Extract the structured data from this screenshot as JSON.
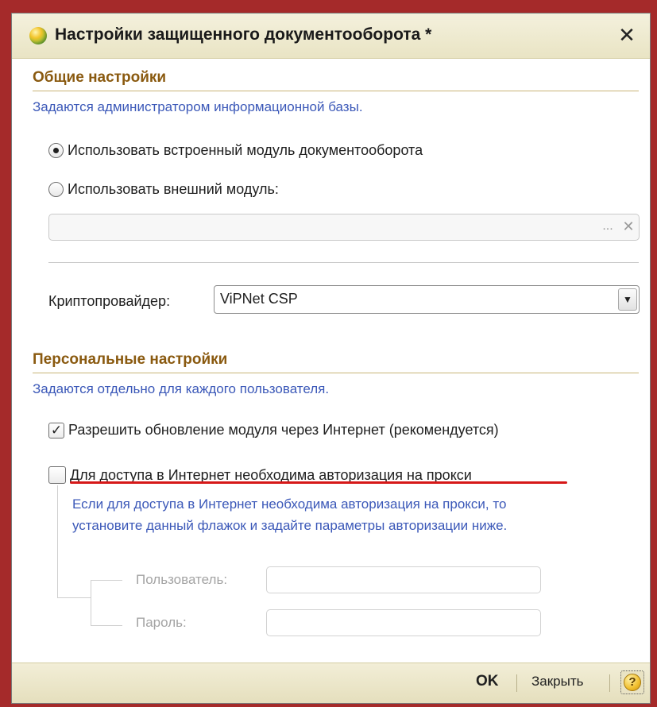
{
  "window": {
    "title": "Настройки защищенного документооборота *",
    "close_symbol": "✕"
  },
  "general": {
    "heading": "Общие настройки",
    "hint": "Задаются администратором информационной базы.",
    "radio_builtin": "Использовать встроенный модуль документооборота",
    "radio_external": "Использовать внешний модуль:",
    "selected": "builtin",
    "external_path_value": "",
    "browse_symbol": "...",
    "clear_symbol": "✕",
    "crypto_label": "Криптопровайдер:",
    "crypto_value": "ViPNet CSP"
  },
  "personal": {
    "heading": "Персональные настройки",
    "hint": "Задаются отдельно для каждого пользователя.",
    "update_checkbox_label": "Разрешить обновление модуля через Интернет (рекомендуется)",
    "update_checked": true,
    "proxy_checkbox_label": "Для доступа в Интернет необходима авторизация на прокси",
    "proxy_checked": false,
    "proxy_note_line1": "Если для доступа в Интернет необходима авторизация на прокси, то",
    "proxy_note_line2": "установите данный флажок и задайте параметры авторизации ниже.",
    "user_label": "Пользователь:",
    "password_label": "Пароль:"
  },
  "footer": {
    "ok_label": "OK",
    "close_label": "Закрыть",
    "help_symbol": "?"
  },
  "colors": {
    "section_heading": "#8a5a10",
    "hint_text": "#3b58b8",
    "annotation_underline": "#d61818",
    "background_frame": "#a52a2a"
  }
}
